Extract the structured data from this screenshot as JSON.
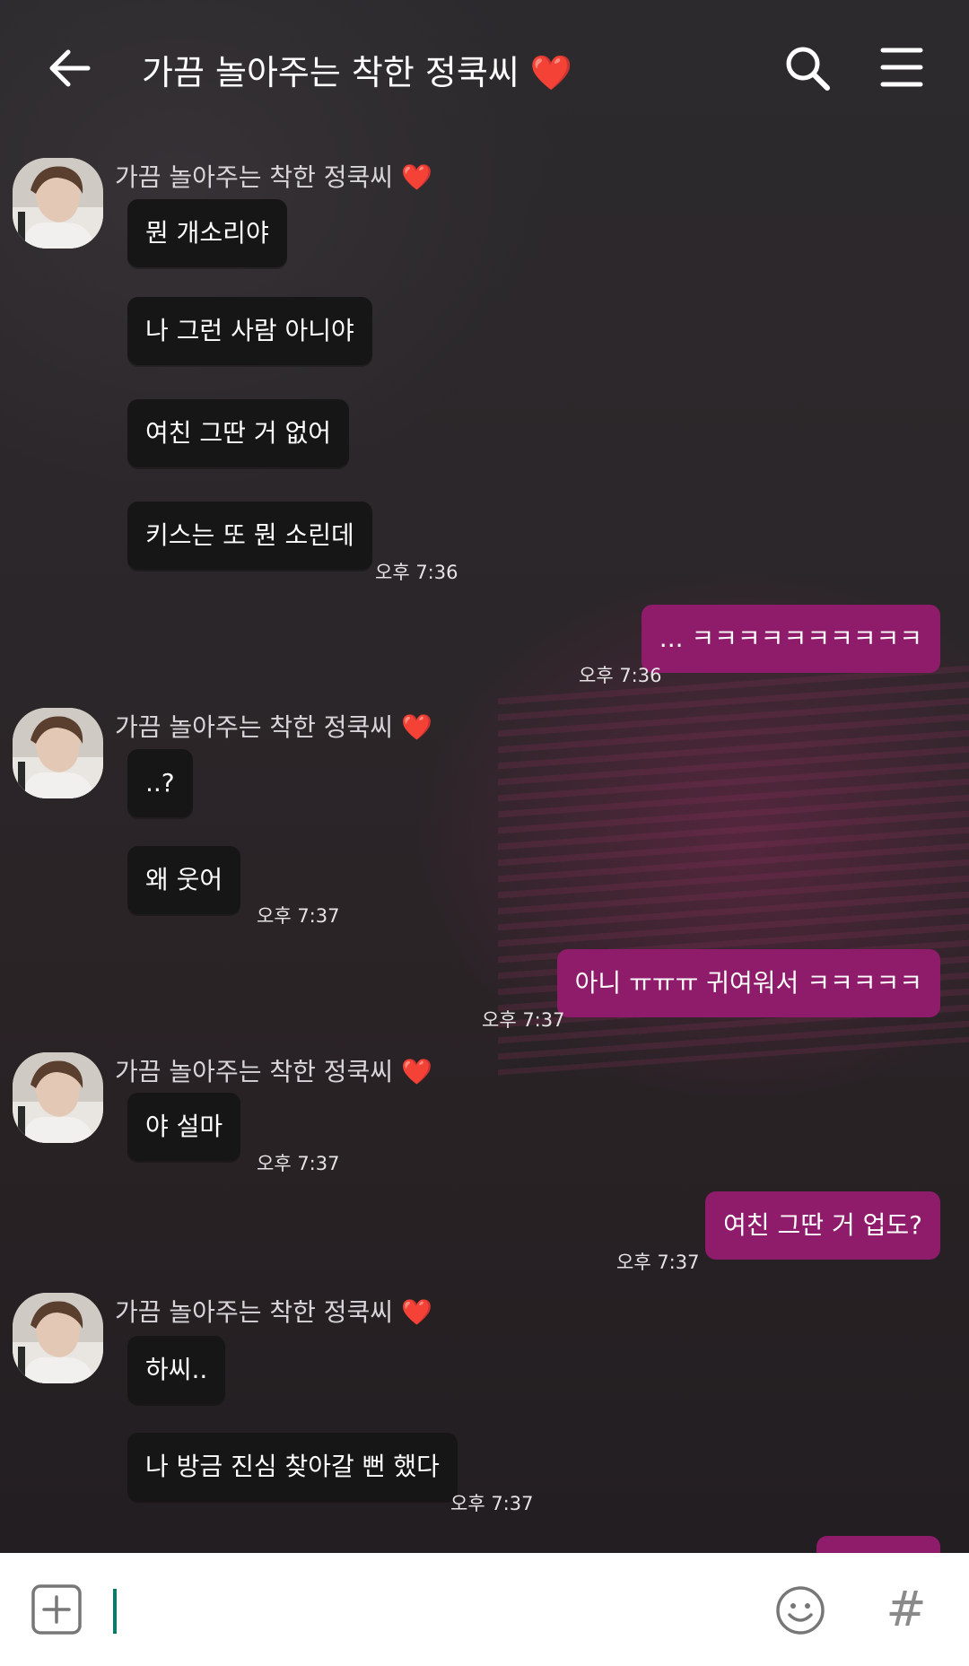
{
  "header": {
    "back_label": "←",
    "title": "가끔 놀아주는 착한 정쿡씨",
    "title_heart": "❤️"
  },
  "messages": {
    "group1": {
      "sender": "가끔 놀아주는 착한 정쿡씨",
      "heart": "❤️",
      "bubbles": [
        "뭔 개소리야",
        "나 그런 사람 아니야",
        "여친 그딴 거 없어",
        "키스는 또 뭔 소린데"
      ],
      "time": "오후 7:36"
    },
    "out1": {
      "text": "... ㅋㅋㅋㅋㅋㅋㅋㅋㅋㅋ",
      "time": "오후 7:36"
    },
    "group2": {
      "sender": "가끔 놀아주는 착한 정쿡씨",
      "heart": "❤️",
      "bubbles": [
        "..?",
        "왜 웃어"
      ],
      "time": "오후 7:37"
    },
    "out2": {
      "text": "아니 ㅠㅠㅠ 귀여워서 ㅋㅋㅋㅋㅋ",
      "time": "오후 7:37"
    },
    "group3": {
      "sender": "가끔 놀아주는 착한 정쿡씨",
      "heart": "❤️",
      "bubbles": [
        "야 설마"
      ],
      "time": "오후 7:37"
    },
    "out3": {
      "text": "여친 그딴 거 업도?",
      "time": "오후 7:37"
    },
    "group4": {
      "sender": "가끔 놀아주는 착한 정쿡씨",
      "heart": "❤️",
      "bubbles": [
        "하씨..",
        "나 방금 진심 찾아갈 뻔 했다"
      ],
      "time": "오후 7:37"
    }
  },
  "input": {
    "placeholder": "",
    "hash_label": "#"
  },
  "colors": {
    "incoming_bubble": "#171616",
    "outgoing_bubble": "#8e1c6b",
    "heart": "#e8253f",
    "cursor": "#0b7a6a"
  },
  "icons": [
    "back-arrow-icon",
    "search-icon",
    "menu-icon",
    "plus-icon",
    "emoji-icon",
    "hashtag-icon"
  ]
}
